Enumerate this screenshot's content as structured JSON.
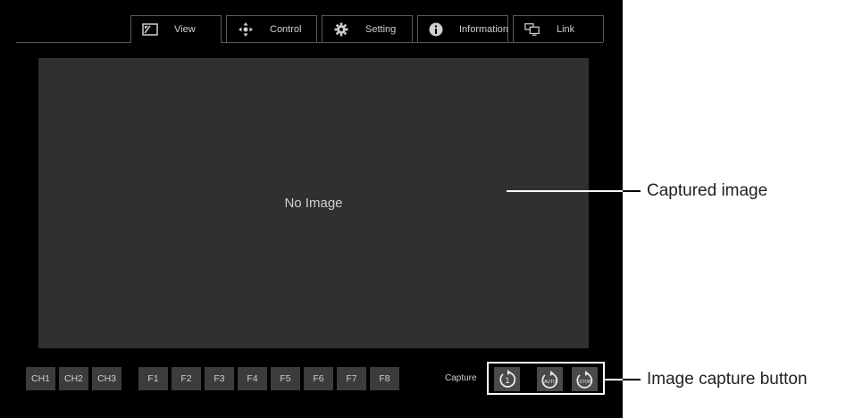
{
  "tabs": [
    {
      "label": "View",
      "icon": "view-icon",
      "active": true
    },
    {
      "label": "Control",
      "icon": "move-arrows-icon",
      "active": false
    },
    {
      "label": "Setting",
      "icon": "gear-icon",
      "active": false
    },
    {
      "label": "Information",
      "icon": "info-icon",
      "active": false
    },
    {
      "label": "Link",
      "icon": "monitors-icon",
      "active": false
    }
  ],
  "viewer": {
    "placeholder": "No Image"
  },
  "channels": [
    "CH1",
    "CH2",
    "CH3"
  ],
  "function_keys": [
    "F1",
    "F2",
    "F3",
    "F4",
    "F5",
    "F6",
    "F7",
    "F8"
  ],
  "capture": {
    "label": "Capture",
    "buttons": [
      {
        "icon": "capture-once-icon",
        "text": "1"
      },
      {
        "icon": "capture-auto-icon",
        "text": "AUTO"
      },
      {
        "icon": "capture-stop-icon",
        "text": "STOP"
      }
    ]
  },
  "callouts": {
    "captured_image": "Captured image",
    "capture_button": "Image capture button"
  }
}
